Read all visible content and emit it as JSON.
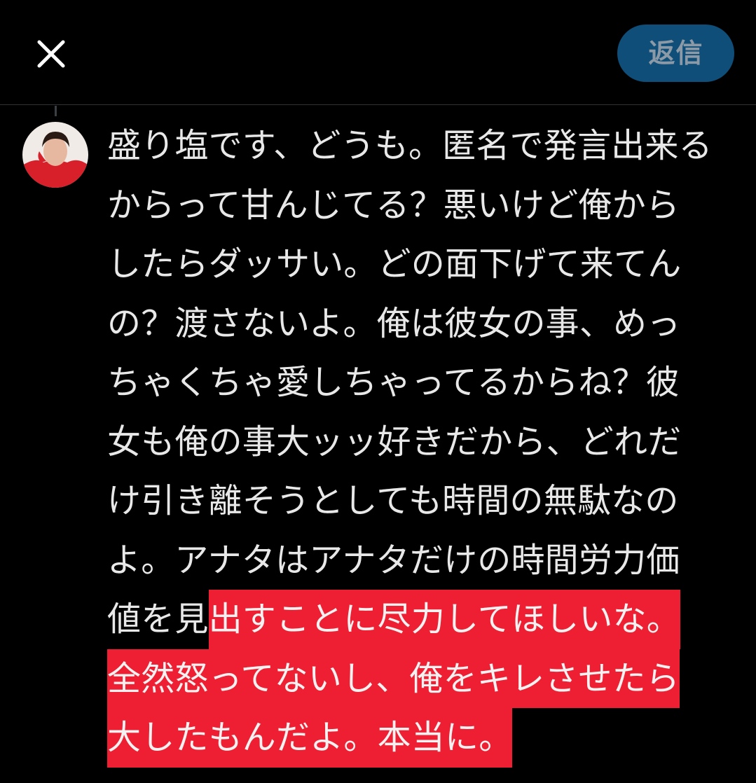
{
  "header": {
    "reply_label": "返信"
  },
  "colors": {
    "background": "#000000",
    "reply_button_bg": "#0f4e78",
    "reply_button_text": "#8b9aa6",
    "highlight": "#ef1f33"
  },
  "icons": {
    "close": "close-icon",
    "avatar": "avatar"
  },
  "compose": {
    "lines": [
      "盛り塩です、どうも。匿名で発言出来る",
      "からって甘んじてる？悪いけど俺から",
      "したらダッサい。どの面下げて来てん",
      "の？渡さないよ。俺は彼女の事、めっ",
      "ちゃくちゃ愛しちゃってるからね？彼",
      "女も俺の事大ッッ好きだから、どれだ",
      "け引き離そうとしても時間の無駄なの",
      "よ。アナタはアナタだけの時間労力価"
    ],
    "line9_plain": "値を見",
    "line9_highlight": "出すことに尽力してほしいな。",
    "line10_highlight": "全然怒ってないし、俺をキレさせたら",
    "line11_highlight": "大したもんだよ。本当に。"
  }
}
